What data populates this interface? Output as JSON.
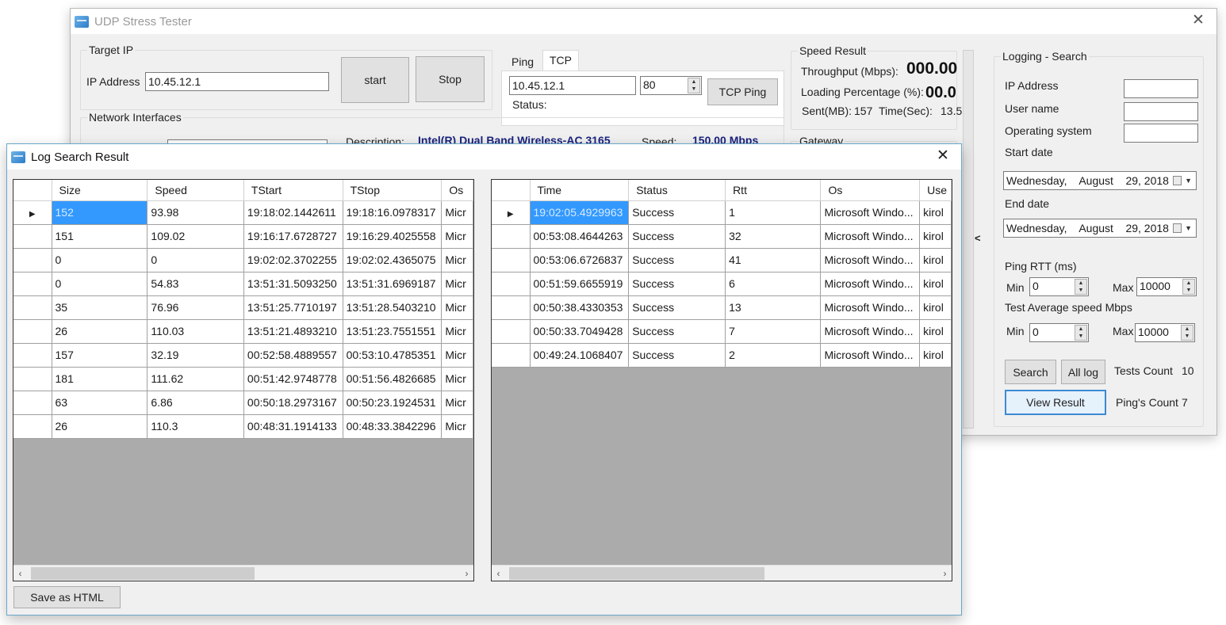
{
  "main_window": {
    "title": "UDP Stress Tester",
    "close_glyph": "✕",
    "target_ip": {
      "group_label": "Target IP",
      "ip_label": "IP Address",
      "ip_value": "10.45.12.1",
      "start_label": "start",
      "stop_label": "Stop"
    },
    "ping_tabs": {
      "tabs": [
        {
          "label": "Ping"
        },
        {
          "label": "TCP Ping"
        }
      ],
      "active_tab": "TCP Ping",
      "host_value": "10.45.12.1",
      "port_value": "80",
      "status_label": "Status:",
      "tcp_ping_button": "TCP Ping"
    },
    "speed_result": {
      "group_label": "Speed Result",
      "throughput_label": "Throughput (Mbps):",
      "throughput_value": "000.00",
      "loading_label": "Loading Percentage (%):",
      "loading_value": "00.0",
      "sent_label": "Sent(MB):",
      "sent_value": "157",
      "time_label": "Time(Sec):",
      "time_value": "13.5"
    },
    "network_interfaces": {
      "group_label": "Network Interfaces",
      "description_label": "Description:",
      "description_value": "Intel(R) Dual Band Wireless-AC 3165",
      "speed_label": "Speed:",
      "speed_value": "150.00 Mbps"
    },
    "gateway": {
      "group_label": "Gateway"
    },
    "splitter_glyph": "<",
    "logging_search": {
      "group_label": "Logging - Search",
      "ip_label": "IP Address",
      "ip_value": "",
      "user_label": "User name",
      "user_value": "",
      "os_label": "Operating system",
      "os_value": "",
      "start_date_label": "Start date",
      "start_date_value": "Wednesday,    August    29, 2018",
      "end_date_label": "End date",
      "end_date_value": "Wednesday,    August    29, 2018",
      "ping_rtt_label": "Ping RTT (ms)",
      "rtt_min_label": "Min",
      "rtt_min_value": "0",
      "rtt_max_label": "Max",
      "rtt_max_value": "10000",
      "avg_speed_label": "Test Average speed Mbps",
      "speed_min_label": "Min",
      "speed_min_value": "0",
      "speed_max_label": "Max",
      "speed_max_value": "10000",
      "search_button": "Search",
      "all_log_button": "All log",
      "tests_count_label": "Tests Count",
      "tests_count_value": "10",
      "view_result_button": "View Result",
      "pings_count_label": "Ping's Count",
      "pings_count_value": "7"
    }
  },
  "log_window": {
    "title": "Log Search Result",
    "close_glyph": "✕",
    "tests_table": {
      "columns": [
        "Size",
        "Speed",
        "TStart",
        "TStop",
        "Os"
      ],
      "selected_row": 0,
      "rows": [
        [
          "152",
          "93.98",
          "19:18:02.1442611",
          "19:18:16.0978317",
          "Micr"
        ],
        [
          "151",
          "109.02",
          "19:16:17.6728727",
          "19:16:29.4025558",
          "Micr"
        ],
        [
          "0",
          "0",
          "19:02:02.3702255",
          "19:02:02.4365075",
          "Micr"
        ],
        [
          "0",
          "54.83",
          "13:51:31.5093250",
          "13:51:31.6969187",
          "Micr"
        ],
        [
          "35",
          "76.96",
          "13:51:25.7710197",
          "13:51:28.5403210",
          "Micr"
        ],
        [
          "26",
          "110.03",
          "13:51:21.4893210",
          "13:51:23.7551551",
          "Micr"
        ],
        [
          "157",
          "32.19",
          "00:52:58.4889557",
          "00:53:10.4785351",
          "Micr"
        ],
        [
          "181",
          "111.62",
          "00:51:42.9748778",
          "00:51:56.4826685",
          "Micr"
        ],
        [
          "63",
          "6.86",
          "00:50:18.2973167",
          "00:50:23.1924531",
          "Micr"
        ],
        [
          "26",
          "110.3",
          "00:48:31.1914133",
          "00:48:33.3842296",
          "Micr"
        ]
      ]
    },
    "pings_table": {
      "columns": [
        "Time",
        "Status",
        "Rtt",
        "Os",
        "Use"
      ],
      "selected_row": 0,
      "rows": [
        [
          "19:02:05.4929963",
          "Success",
          "1",
          "Microsoft Windo...",
          "kirol"
        ],
        [
          "00:53:08.4644263",
          "Success",
          "32",
          "Microsoft Windo...",
          "kirol"
        ],
        [
          "00:53:06.6726837",
          "Success",
          "41",
          "Microsoft Windo...",
          "kirol"
        ],
        [
          "00:51:59.6655919",
          "Success",
          "6",
          "Microsoft Windo...",
          "kirol"
        ],
        [
          "00:50:38.4330353",
          "Success",
          "13",
          "Microsoft Windo...",
          "kirol"
        ],
        [
          "00:50:33.7049428",
          "Success",
          "7",
          "Microsoft Windo...",
          "kirol"
        ],
        [
          "00:49:24.1068407",
          "Success",
          "2",
          "Microsoft Windo...",
          "kirol"
        ]
      ]
    },
    "scroll_left_glyph": "‹",
    "scroll_right_glyph": "›",
    "row_indicator_glyph": "▶",
    "save_button": "Save as HTML"
  }
}
